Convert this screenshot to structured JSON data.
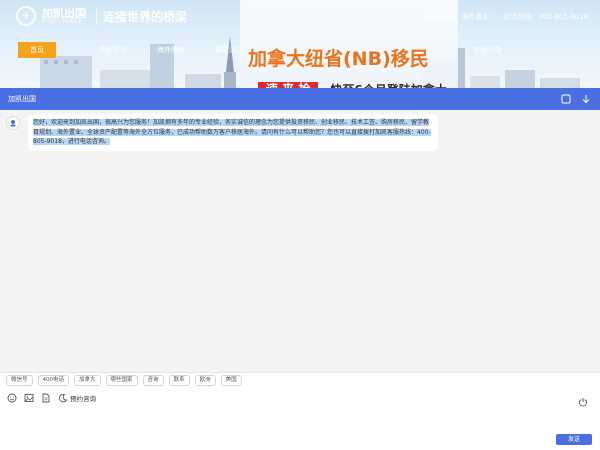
{
  "site": {
    "logo_name": "加凯出国",
    "logo_sub": "ADD LIUXUE",
    "slogan": "连接世界的桥梁",
    "top_links": [
      "移民国家：海外置业",
      "咨询热线：400-805-9018"
    ],
    "nav": [
      "首页",
      "移民项目",
      "海外购房",
      "最新活动",
      "加凯出国"
    ],
    "banner_title": "加拿大纽省(NB)移民",
    "banner_badge": "速 来 抢",
    "banner_tail": "快至6个月登陆加拿大"
  },
  "chat": {
    "title": "加凯出国",
    "greeting": "您好，欢迎来到加凯出国，很高兴为您服务！加凯拥有多年的专业经验，务实诚信的理念为您提供投资移民、创业移民、技术工签、购房移民、留学教育规划、海外置业、全球资产配置等海外全方位服务，已成功帮助数万客户移居海外。请问有什么可以帮助您？您也可以直接拨打加凯客服热线：400-805-9018，进行电话咨询。",
    "quick_replies": [
      "微信号",
      "400电话",
      "加拿大",
      "哪些国家",
      "咨询",
      "联系",
      "欧洲",
      "美国"
    ],
    "appointment_label": "预约咨询",
    "send_label": "发送"
  },
  "colors": {
    "header_blue": "#4a6fe0",
    "nav_active": "#f5a21c",
    "banner_title": "#e8741d",
    "badge_red": "#e02b2b",
    "highlight": "#b8d7f7"
  },
  "icons": [
    "minimize-icon",
    "close-chevron-icon",
    "emoji-icon",
    "image-icon",
    "file-icon",
    "moon-icon",
    "power-icon"
  ]
}
